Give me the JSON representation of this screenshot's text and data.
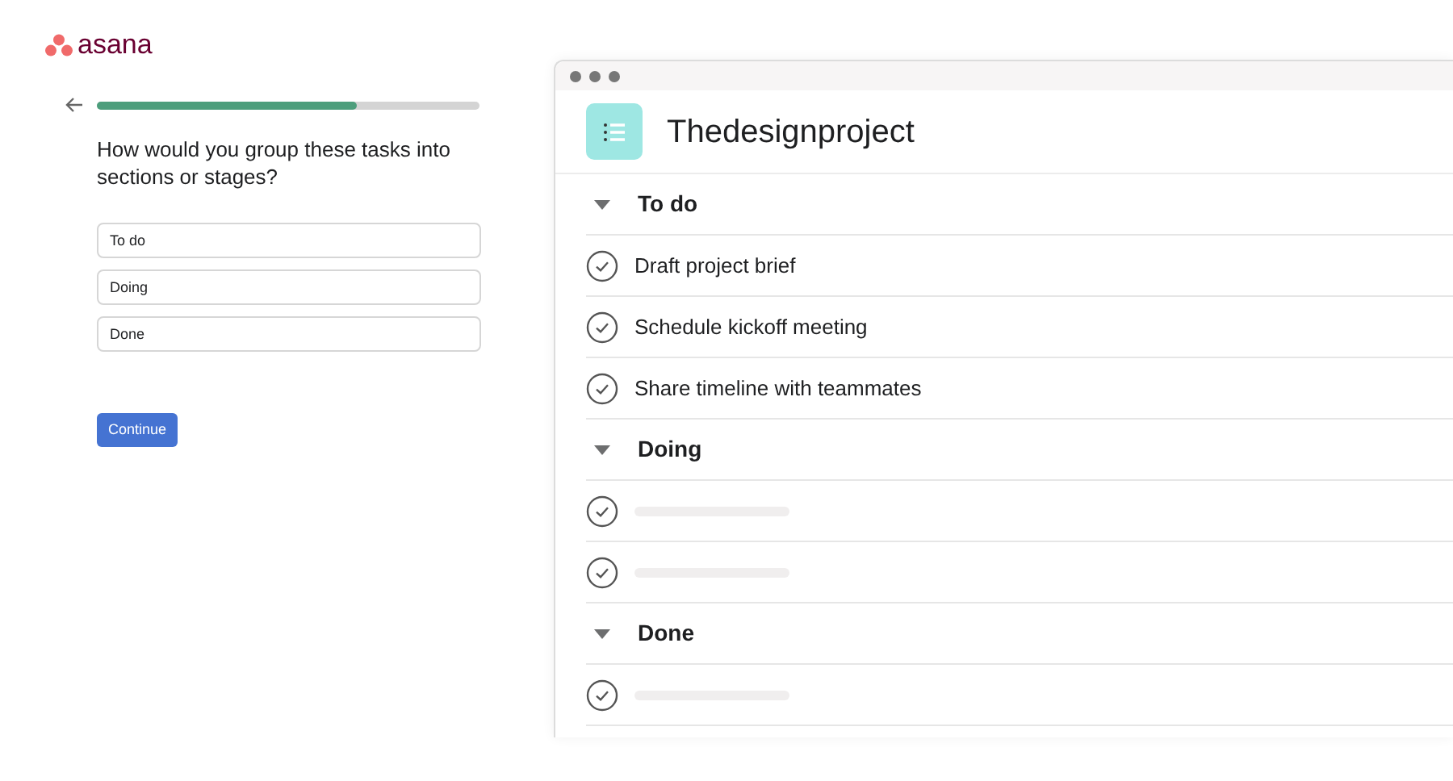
{
  "logo": {
    "text": "asana"
  },
  "progress": {
    "level": 0.68
  },
  "question": "How would you group these tasks into sections or stages?",
  "fields": [
    {
      "value": "To do"
    },
    {
      "value": "Doing"
    },
    {
      "value": "Done"
    }
  ],
  "continue_button": "Continue",
  "preview": {
    "project_title": "Thedesignproject",
    "sections": [
      {
        "name": "To do",
        "expanded": true,
        "tasks": [
          {
            "kind": "text",
            "title": "Draft project brief"
          },
          {
            "kind": "text",
            "title": "Schedule kickoff meeting"
          },
          {
            "kind": "text",
            "title": "Share timeline with teammates"
          }
        ]
      },
      {
        "name": "Doing",
        "expanded": true,
        "tasks": [
          {
            "kind": "placeholder"
          },
          {
            "kind": "placeholder"
          }
        ]
      },
      {
        "name": "Done",
        "expanded": true,
        "tasks": [
          {
            "kind": "placeholder"
          }
        ]
      }
    ]
  }
}
